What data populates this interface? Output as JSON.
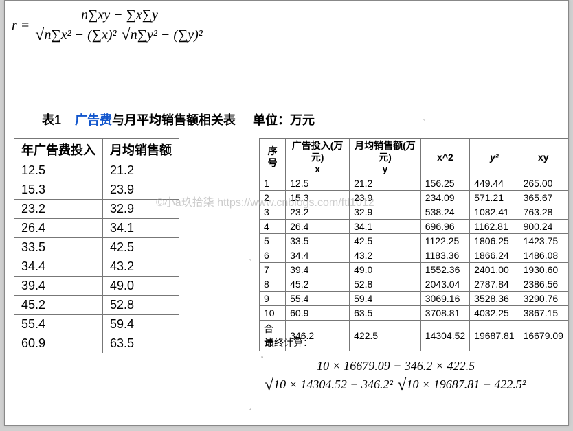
{
  "formula_top": {
    "lhs": "r =",
    "num": "n∑xy − ∑x∑y",
    "den_sqrt1": "n∑x² − (∑x)²",
    "den_sqrt2": "n∑y² − (∑y)²"
  },
  "caption": {
    "prefix": "表1",
    "blue": "广告费",
    "rest": "与月平均销售额相关表",
    "unit": "单位：万元"
  },
  "table1": {
    "headers": [
      "年广告费投入",
      "月均销售额"
    ],
    "rows": [
      [
        "12.5",
        "21.2"
      ],
      [
        "15.3",
        "23.9"
      ],
      [
        "23.2",
        "32.9"
      ],
      [
        "26.4",
        "34.1"
      ],
      [
        "33.5",
        "42.5"
      ],
      [
        "34.4",
        "43.2"
      ],
      [
        "39.4",
        "49.0"
      ],
      [
        "45.2",
        "52.8"
      ],
      [
        "55.4",
        "59.4"
      ],
      [
        "60.9",
        "63.5"
      ]
    ]
  },
  "table2": {
    "headers": [
      "序号",
      "广告投入(万元)\nx",
      "月均销售额(万元)\ny",
      "x^2",
      "y²",
      "xy"
    ],
    "rows": [
      [
        "1",
        "12.5",
        "21.2",
        "156.25",
        "449.44",
        "265.00"
      ],
      [
        "2",
        "15.3",
        "23.9",
        "234.09",
        "571.21",
        "365.67"
      ],
      [
        "3",
        "23.2",
        "32.9",
        "538.24",
        "1082.41",
        "763.28"
      ],
      [
        "4",
        "26.4",
        "34.1",
        "696.96",
        "1162.81",
        "900.24"
      ],
      [
        "5",
        "33.5",
        "42.5",
        "1122.25",
        "1806.25",
        "1423.75"
      ],
      [
        "6",
        "34.4",
        "43.2",
        "1183.36",
        "1866.24",
        "1486.08"
      ],
      [
        "7",
        "39.4",
        "49.0",
        "1552.36",
        "2401.00",
        "1930.60"
      ],
      [
        "8",
        "45.2",
        "52.8",
        "2043.04",
        "2787.84",
        "2386.56"
      ],
      [
        "9",
        "55.4",
        "59.4",
        "3069.16",
        "3528.36",
        "3290.76"
      ],
      [
        "10",
        "60.9",
        "63.5",
        "3708.81",
        "4032.25",
        "3867.15"
      ]
    ],
    "sum_label": "合计",
    "sum": [
      "346.2",
      "422.5",
      "",
      "14304.52",
      "19687.81",
      "16679.09"
    ]
  },
  "final": {
    "label": "最终计算：",
    "num": "10 × 16679.09 − 346.2 × 422.5",
    "den_sqrt1": "10 × 14304.52 − 346.2²",
    "den_sqrt2": "10 × 19687.81 − 422.5²"
  },
  "watermark": "©小a玖拾柒  https://www.cnblogs.com/ftl1012"
}
